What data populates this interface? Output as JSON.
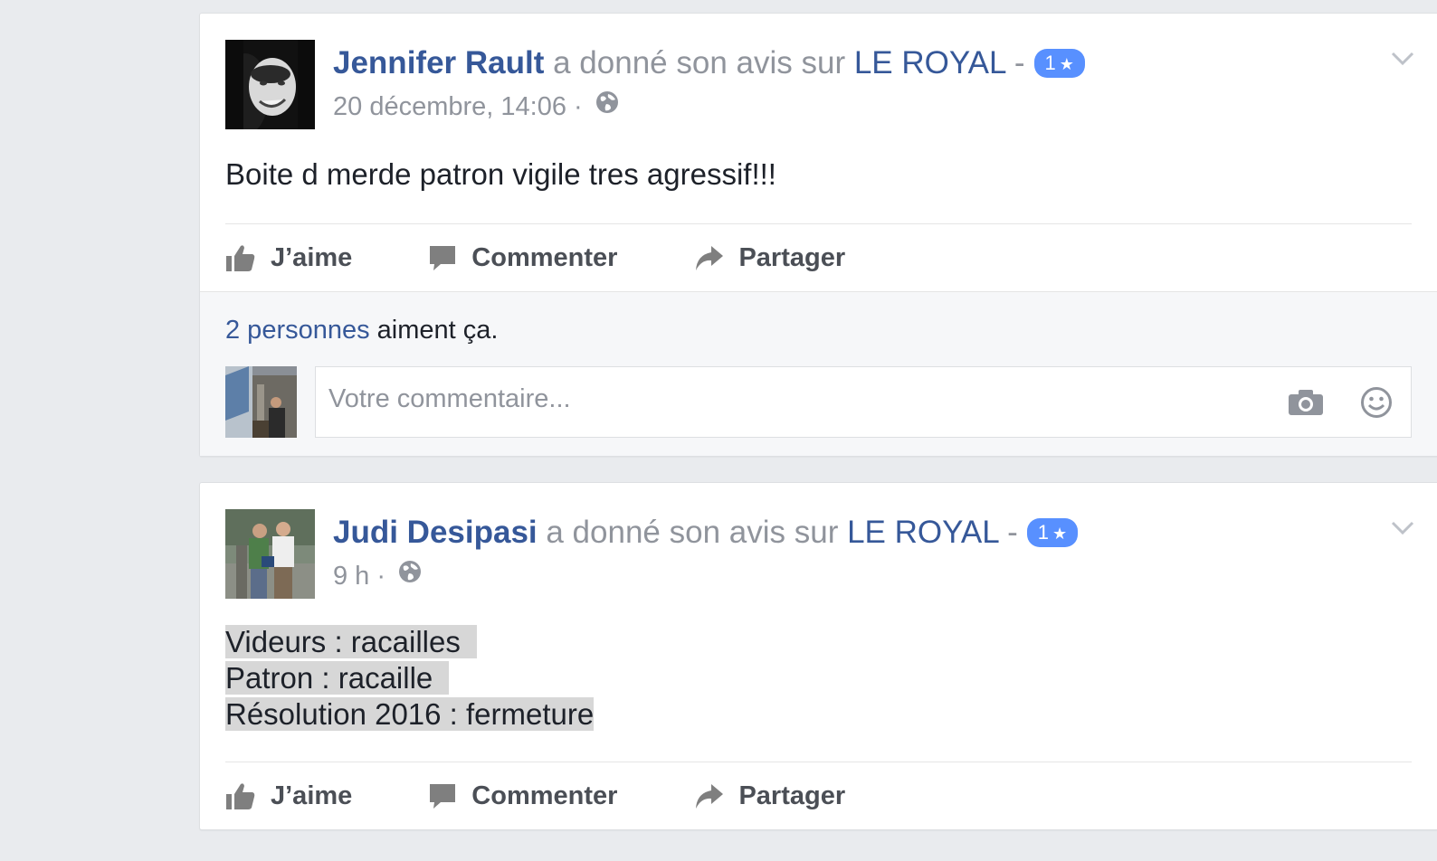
{
  "posts": [
    {
      "author": "Jennifer Rault",
      "action_text": " a donné son avis sur ",
      "page": "LE ROYAL",
      "separator": " -",
      "rating": "1",
      "rating_star": "★",
      "timestamp": "20 décembre, 14:06 ·",
      "text_lines": [
        "Boite d merde patron vigile tres agressif!!!"
      ],
      "actions": {
        "like": "J’aime",
        "comment": "Commenter",
        "share": "Partager"
      },
      "likes_count_link": "2 personnes",
      "likes_suffix": " aiment ça.",
      "comment_placeholder": "Votre commentaire..."
    },
    {
      "author": "Judi Desipasi",
      "action_text": " a donné son avis sur ",
      "page": "LE ROYAL",
      "separator": " -",
      "rating": "1",
      "rating_star": "★",
      "timestamp": "9 h ·",
      "text_lines": [
        "Videurs : racailles",
        "Patron : racaille",
        "Résolution 2016 : fermeture"
      ],
      "actions": {
        "like": "J’aime",
        "comment": "Commenter",
        "share": "Partager"
      }
    }
  ],
  "colors": {
    "link": "#365899",
    "meta": "#90949c",
    "badge": "#5890ff",
    "background": "#e9ebee"
  },
  "icons": [
    "globe-icon",
    "chevron-down-icon",
    "thumbs-up-icon",
    "comment-icon",
    "share-arrow-icon",
    "camera-icon",
    "smiley-icon"
  ]
}
